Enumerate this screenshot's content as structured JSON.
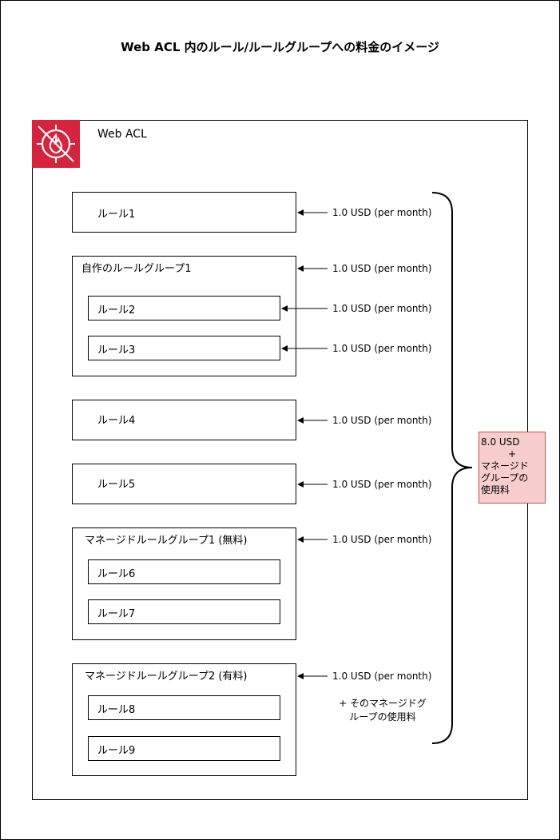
{
  "title": "Web ACL 内のルール/ルールグループへの料金のイメージ",
  "web_acl": {
    "label": "Web ACL",
    "icon": "waf-firewall-icon"
  },
  "items": [
    {
      "label": "ルール1",
      "price": "1.0 USD (per month)"
    },
    {
      "label": "自作のルールグループ1",
      "price": "1.0 USD (per month)",
      "children": [
        {
          "label": "ルール2",
          "price": "1.0 USD (per month)"
        },
        {
          "label": "ルール3",
          "price": "1.0 USD (per month)"
        }
      ]
    },
    {
      "label": "ルール4",
      "price": "1.0 USD (per month)"
    },
    {
      "label": "ルール5",
      "price": "1.0 USD (per month)"
    },
    {
      "label": "マネージドルールグループ1 (無料)",
      "price": "1.0 USD (per month)",
      "children": [
        {
          "label": "ルール6"
        },
        {
          "label": "ルール7"
        }
      ]
    },
    {
      "label": "マネージドルールグループ2 (有料)",
      "price": "1.0 USD (per month)",
      "note_line1": "+ そのマネージドグ",
      "note_line2": "ループの使用料",
      "children": [
        {
          "label": "ルール8"
        },
        {
          "label": "ルール9"
        }
      ]
    }
  ],
  "total": {
    "amount": "8.0 USD",
    "plus": "+",
    "line1": "マネージド",
    "line2": "グループの",
    "line3": "使用料"
  },
  "colors": {
    "icon_bg": "#d6243f",
    "total_fill": "#f8cecc",
    "total_border": "#b85450"
  }
}
